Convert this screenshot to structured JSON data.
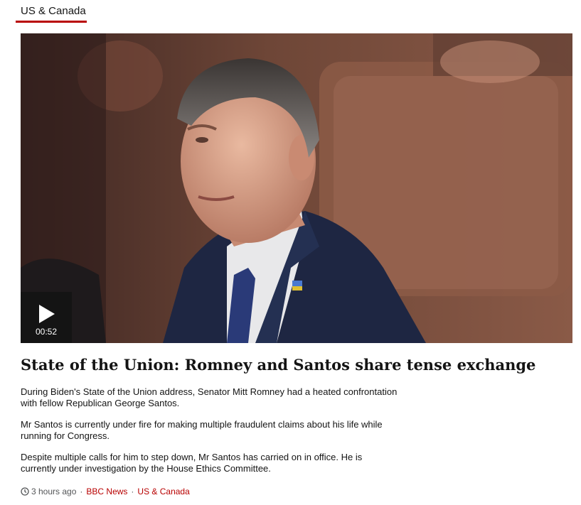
{
  "section_tab": {
    "label": "US & Canada"
  },
  "media": {
    "duration": "00:52",
    "play_icon": "play-icon"
  },
  "article": {
    "headline": "State of the Union: Romney and Santos share tense exchange",
    "paragraphs": [
      "During Biden's State of the Union address, Senator Mitt Romney had a heated confrontation with fellow Republican George Santos.",
      "Mr Santos is currently under fire for making multiple fraudulent claims about his life while running for Congress.",
      "Despite multiple calls for him to step down, Mr Santos has carried on in office. He is currently under investigation by the House Ethics Committee."
    ]
  },
  "meta": {
    "time_icon": "clock-icon",
    "time": "3 hours ago",
    "source": "BBC News",
    "section": "US & Canada",
    "link_color": "#b80000"
  },
  "colors": {
    "accent": "#b80000",
    "text": "#141414",
    "meta_text": "#545658"
  }
}
